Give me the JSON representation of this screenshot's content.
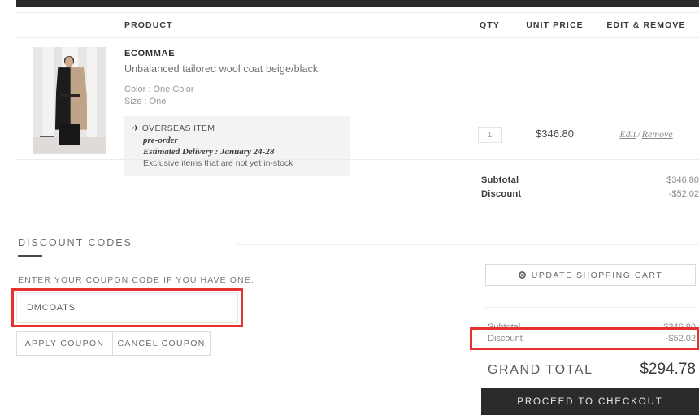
{
  "topbar": {
    "label": "site-navigation-bar"
  },
  "cart_table": {
    "headers": {
      "product": "PRODUCT",
      "qty": "QTY",
      "unit_price": "UNIT PRICE",
      "edit_remove": "EDIT & REMOVE"
    },
    "items": [
      {
        "brand": "ECOMMAE",
        "name": "Unbalanced tailored wool coat beige/black",
        "color": "Color : One Color",
        "size": "Size : One",
        "badge": {
          "icon": "airplane-icon",
          "glyph": "✈",
          "title": "OVERSEAS ITEM",
          "line2": "pre-order",
          "line3": "Estimated Delivery : January 24-28",
          "line4": "Exclusive items that are not yet in-stock"
        },
        "qty": "1",
        "unit_price": "$346.80",
        "edit_label": "Edit",
        "separator": "/",
        "remove_label": "Remove"
      }
    ]
  },
  "table_totals": [
    {
      "label": "Subtotal",
      "value": "$346.80"
    },
    {
      "label": "Discount",
      "value": "-$52.02"
    }
  ],
  "discount_codes": {
    "heading": "DISCOUNT CODES",
    "subtitle": "ENTER YOUR COUPON CODE IF YOU HAVE ONE.",
    "input_value": "DMCOATS",
    "input_placeholder": "Enter coupon code",
    "apply_label": "APPLY COUPON",
    "cancel_label": "CANCEL COUPON"
  },
  "summary": {
    "update_label": "UPDATE SHOPPING CART",
    "update_icon": "refresh-icon",
    "rows": [
      {
        "label": "Subtotal",
        "value": "$346.80"
      },
      {
        "label": "Discount",
        "value": "-$52.02"
      }
    ],
    "grand_total_label": "GRAND TOTAL",
    "grand_total_value": "$294.78",
    "checkout_label": "PROCEED TO CHECKOUT"
  },
  "highlights": {
    "coupon_box_color": "#e8312f",
    "discount_row_color": "#e8312f"
  }
}
